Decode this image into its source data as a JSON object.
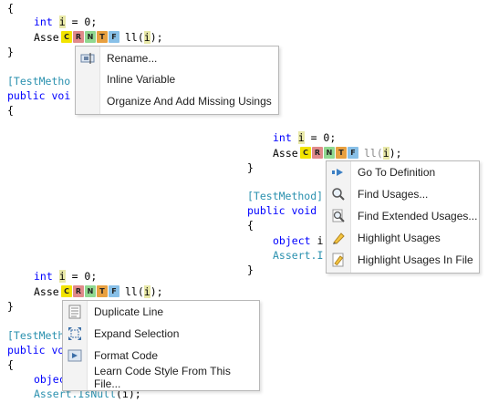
{
  "code": {
    "brace_open": "{",
    "brace_close": "}",
    "int_kw": "int",
    "var_i": "i",
    "assign_zero": " = 0;",
    "asse": "Asse",
    "ll": "ll(",
    "i_arg": "i",
    "close_paren": ");",
    "test_method": "[TestMethod]",
    "test_meth_partial": "[TestMeth",
    "test_metho_partial": "[TestMetho",
    "test_method_bracket": "]",
    "public_kw": "public",
    "void_kw": "void",
    "void_partial": "voi",
    "void_trunc": "vo",
    "void_i": "void I",
    "object_kw": "object",
    "object_partial": "objec",
    "object_i": " i",
    "assert_is": "Assert.I",
    "assert_isnull": "Assert.",
    "isnull": "IsNull",
    "isnull_arg": "(i);"
  },
  "letters": [
    "C",
    "R",
    "N",
    "T",
    "F"
  ],
  "menus": {
    "menu1": {
      "items": [
        {
          "label": "Rename...",
          "icon": "rename-icon"
        },
        {
          "label": "Inline Variable",
          "icon": ""
        },
        {
          "label": "Organize And Add Missing Usings",
          "icon": ""
        }
      ]
    },
    "menu2": {
      "items": [
        {
          "label": "Go To Definition",
          "icon": "goto-arrow-icon"
        },
        {
          "label": "Find Usages...",
          "icon": "magnifier-icon"
        },
        {
          "label": "Find Extended Usages...",
          "icon": "magnifier-doc-icon"
        },
        {
          "label": "Highlight Usages",
          "icon": "highlighter-icon"
        },
        {
          "label": "Highlight Usages In File",
          "icon": "highlighter-file-icon"
        }
      ]
    },
    "menu3": {
      "items": [
        {
          "label": "Duplicate Line",
          "icon": "duplicate-line-icon"
        },
        {
          "label": "Expand Selection",
          "icon": "expand-selection-icon"
        },
        {
          "label": "Format Code",
          "icon": "format-code-icon"
        },
        {
          "label": "Learn Code Style From This File...",
          "icon": ""
        }
      ]
    }
  },
  "colors": {
    "keyword": "#0000ff",
    "attribute": "#2b91af",
    "highlight": "#e8e8a8",
    "letter_c": "#f2e400",
    "letter_r": "#e08a8a",
    "letter_n": "#90d890",
    "letter_t": "#e8a040",
    "letter_f": "#88c0e8"
  }
}
